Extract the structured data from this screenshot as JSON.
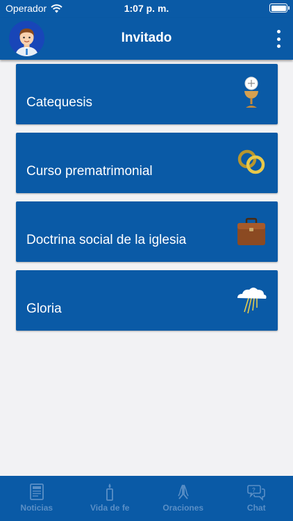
{
  "status_bar": {
    "carrier": "Operador",
    "time": "1:07 p. m."
  },
  "header": {
    "title": "Invitado"
  },
  "cards": [
    {
      "label": "Catequesis",
      "icon": "chalice-host-icon"
    },
    {
      "label": "Curso prematrimonial",
      "icon": "wedding-rings-icon"
    },
    {
      "label": "Doctrina social de la iglesia",
      "icon": "briefcase-icon"
    },
    {
      "label": "Gloria",
      "icon": "cloud-rays-icon"
    }
  ],
  "tabs": [
    {
      "label": "Noticias",
      "icon": "newspaper-icon"
    },
    {
      "label": "Vida de fe",
      "icon": "candle-icon"
    },
    {
      "label": "Oraciones",
      "icon": "praying-hands-icon"
    },
    {
      "label": "Chat",
      "icon": "chat-bubbles-icon"
    }
  ],
  "colors": {
    "primary": "#0a5aa6",
    "background": "#f2f2f4",
    "tab_inactive": "#5a8fc6"
  }
}
